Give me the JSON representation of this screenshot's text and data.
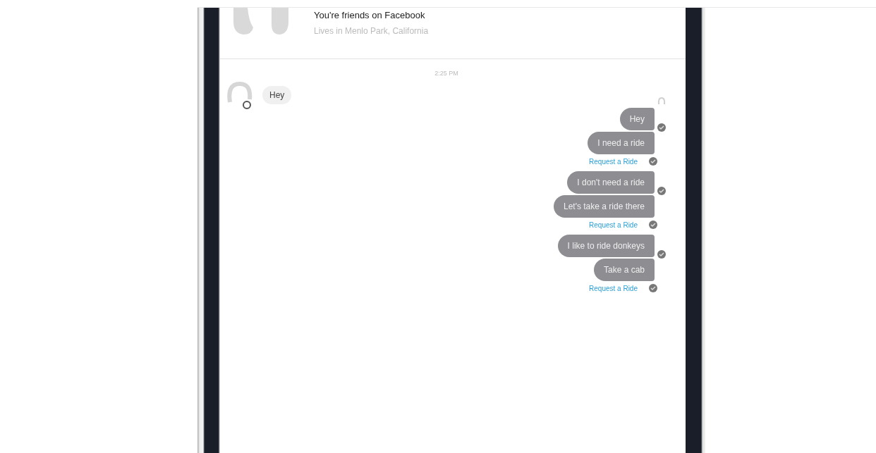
{
  "header": {
    "title": "You're friends on Facebook",
    "subtitle": "Lives in Menlo Park, California"
  },
  "timestamp": "2:25 PM",
  "incoming": [
    {
      "text": "Hey"
    }
  ],
  "outgoing": [
    {
      "kind": "message",
      "text": "Hey",
      "receipt": true
    },
    {
      "kind": "message",
      "text": "I need a ride",
      "receipt": false
    },
    {
      "kind": "link",
      "text": "Request a Ride",
      "receipt": true
    },
    {
      "kind": "message",
      "text": "I don't need a ride",
      "receipt": true
    },
    {
      "kind": "message",
      "text": "Let's take a ride there",
      "receipt": false
    },
    {
      "kind": "link",
      "text": "Request a Ride",
      "receipt": true
    },
    {
      "kind": "message",
      "text": "I like to ride donkeys",
      "receipt": true
    },
    {
      "kind": "message",
      "text": "Take a cab",
      "receipt": false
    },
    {
      "kind": "link",
      "text": "Request a Ride",
      "receipt": true
    }
  ]
}
